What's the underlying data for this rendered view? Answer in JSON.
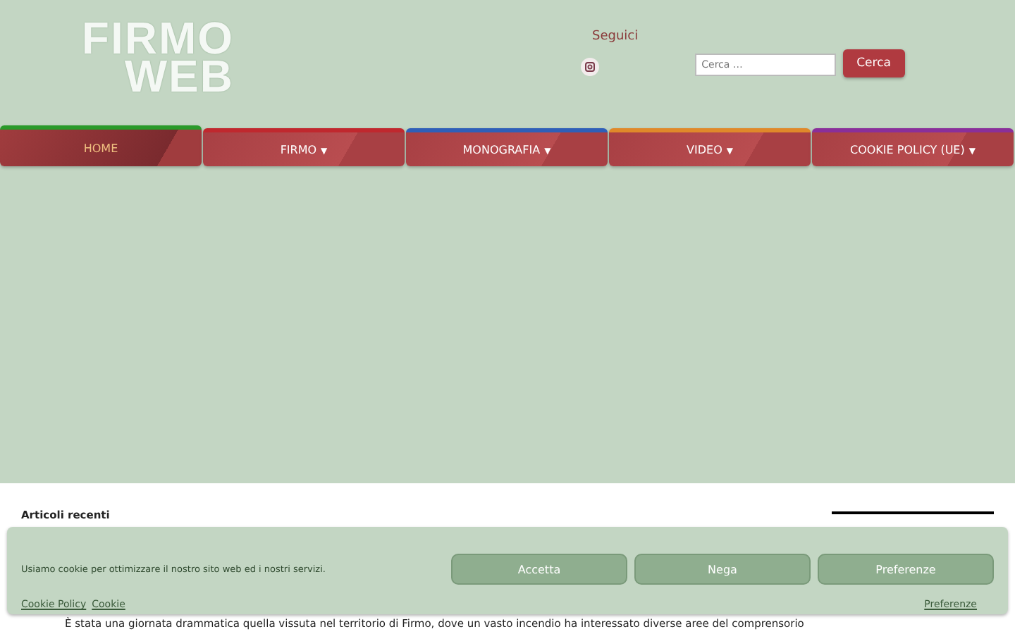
{
  "header": {
    "logo_lines": [
      "FIRMO",
      "WEB"
    ],
    "follow_label": "Seguici",
    "search": {
      "placeholder": "Cerca …",
      "button": "Cerca"
    }
  },
  "nav": [
    {
      "label": "HOME",
      "selected": true,
      "color": "#2a9a2a"
    },
    {
      "label": "FIRMO",
      "caret": "▼",
      "selected": false,
      "color": "#c0282e"
    },
    {
      "label": "MONOGRAFIA",
      "caret": "▼",
      "selected": false,
      "color": "#2f5fb8"
    },
    {
      "label": "VIDEO",
      "caret": "▼",
      "selected": false,
      "color": "#e0892a"
    },
    {
      "label": "COOKIE POLICY (UE)",
      "caret": "▼",
      "selected": false,
      "color": "#8a2f9a"
    }
  ],
  "content": {
    "section_title": "Articoli recenti",
    "excerpt": "È stata una giornata drammatica quella vissuta nel territorio di Firmo, dove un vasto incendio ha interessato diverse aree del comprensorio"
  },
  "cookie_banner": {
    "message": "Usiamo cookie per ottimizzare il nostro sito web ed i nostri servizi.",
    "buttons": [
      "Accetta",
      "Nega",
      "Preferenze"
    ],
    "links": [
      "Cookie Policy",
      "Cookie"
    ],
    "manage_link": "Preferenze"
  }
}
